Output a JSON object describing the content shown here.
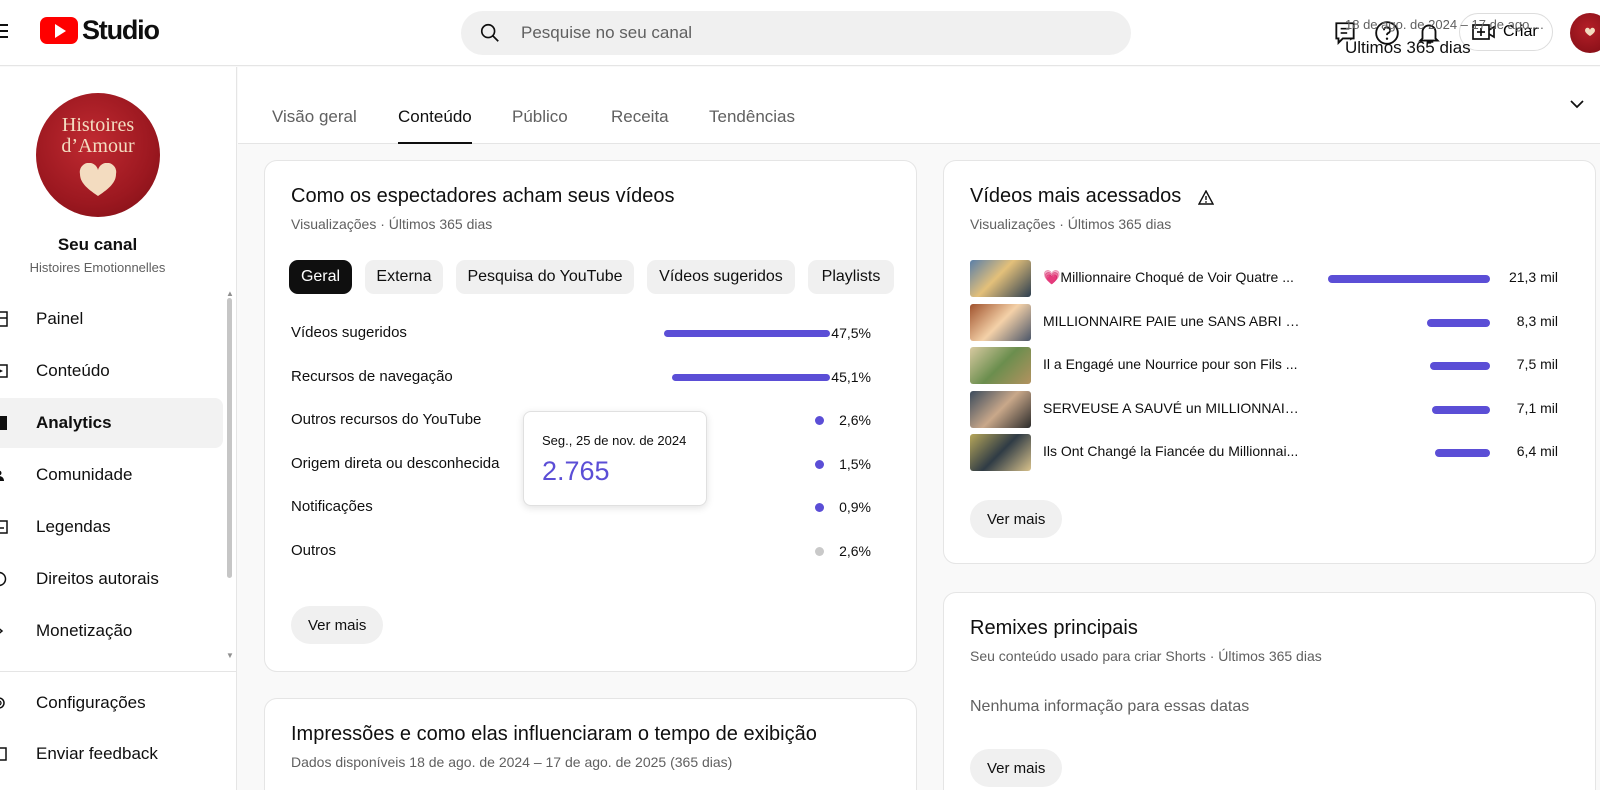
{
  "app": {
    "logo_text": "Studio",
    "search_placeholder": "Pesquise no seu canal",
    "create_label": "Criar",
    "brand_color": "#ff0000",
    "accent_color": "#5b4ed6"
  },
  "sidebar": {
    "channel_avatar_text": "Histoires d’Amour",
    "channel_name": "Seu canal",
    "channel_subtitle": "Histoires Emotionnelles",
    "items": [
      {
        "label": "Painel",
        "icon": "dashboard-icon"
      },
      {
        "label": "Conteúdo",
        "icon": "content-icon"
      },
      {
        "label": "Analytics",
        "icon": "analytics-icon",
        "active": true
      },
      {
        "label": "Comunidade",
        "icon": "community-icon"
      },
      {
        "label": "Legendas",
        "icon": "subtitles-icon"
      },
      {
        "label": "Direitos autorais",
        "icon": "copyright-icon"
      },
      {
        "label": "Monetização",
        "icon": "monetization-icon"
      }
    ],
    "footer_items": [
      {
        "label": "Configurações",
        "icon": "settings-icon"
      },
      {
        "label": "Enviar feedback",
        "icon": "feedback-icon"
      }
    ]
  },
  "tabs": [
    {
      "label": "Visão geral"
    },
    {
      "label": "Conteúdo",
      "active": true
    },
    {
      "label": "Público"
    },
    {
      "label": "Receita"
    },
    {
      "label": "Tendências"
    }
  ],
  "date_range": {
    "dates": "18 de ago. de 2024 – 17 de ago....",
    "label": "Últimos 365 dias"
  },
  "traffic_card": {
    "title": "Como os espectadores acham seus vídeos",
    "subtitle": "Visualizações · Últimos 365 dias",
    "chips": [
      {
        "label": "Geral",
        "active": true
      },
      {
        "label": "Externa"
      },
      {
        "label": "Pesquisa do YouTube"
      },
      {
        "label": "Vídeos sugeridos"
      },
      {
        "label": "Playlists"
      }
    ],
    "sources": [
      {
        "label": "Vídeos sugeridos",
        "pct": "47,5%",
        "value": 47.5
      },
      {
        "label": "Recursos de navegação",
        "pct": "45,1%",
        "value": 45.1
      },
      {
        "label": "Outros recursos do YouTube",
        "pct": "2,6%",
        "value": 2.6
      },
      {
        "label": "Origem direta ou desconhecida",
        "pct": "1,5%",
        "value": 1.5
      },
      {
        "label": "Notificações",
        "pct": "0,9%",
        "value": 0.9
      },
      {
        "label": "Outros",
        "pct": "2,6%",
        "value": 2.6,
        "muted": true
      }
    ],
    "more_label": "Ver mais",
    "tooltip": {
      "date": "Seg., 25 de nov. de 2024",
      "value": "2.765"
    }
  },
  "top_videos_card": {
    "title": "Vídeos mais acessados",
    "subtitle": "Visualizações · Últimos 365 dias",
    "videos": [
      {
        "title": "💗Millionnaire Choqué de Voir Quatre ...",
        "views": "21,3 mil",
        "value": 21.3
      },
      {
        "title": "MILLIONNAIRE PAIE une SANS ABRI p...",
        "views": "8,3 mil",
        "value": 8.3
      },
      {
        "title": "Il a Engagé une Nourrice pour son Fils ...",
        "views": "7,5 mil",
        "value": 7.5
      },
      {
        "title": "SERVEUSE A SAUVÉ un MILLIONNAIRE...",
        "views": "7,1 mil",
        "value": 7.1
      },
      {
        "title": "Ils Ont Changé la Fiancée du Millionnai...",
        "views": "6,4 mil",
        "value": 6.4
      }
    ],
    "more_label": "Ver mais"
  },
  "remix_card": {
    "title": "Remixes principais",
    "subtitle": "Seu conteúdo usado para criar Shorts · Últimos 365 dias",
    "empty_text": "Nenhuma informação para essas datas",
    "more_label": "Ver mais"
  },
  "impressions_card": {
    "title": "Impressões e como elas influenciaram o tempo de exibição",
    "subtitle": "Dados disponíveis 18 de ago. de 2024 – 17 de ago. de 2025 (365 dias)"
  }
}
